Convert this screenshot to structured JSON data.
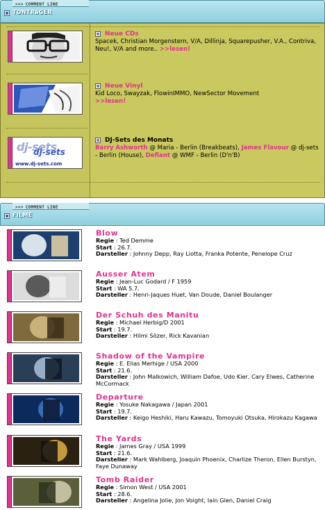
{
  "tontraeger_header": {
    "sub": "COMMENT LINE",
    "chevrons": ">>>",
    "title": "TONTRäGER"
  },
  "filme_header": {
    "sub": "COMMENT LINE",
    "chevrons": ">>>",
    "title": "FILME"
  },
  "music": [
    {
      "heading": "Neue CDs",
      "body": "Spacek, Christian Morgenstern, V/A, Dillinja, Squarepusher, V.A., Contriva, Neu!, V/A and more..",
      "link": ">>lesen!"
    },
    {
      "heading": "Neue Vinyl",
      "body": "Kid Loco, Swayzak, FlowinIMMO, NewSector Movement",
      "link": ">>lesen!"
    },
    {
      "heading": "DJ-Sets des Monats",
      "parts": [
        {
          "t": "Barry Ashworth",
          "pink": true
        },
        {
          "t": " @ Maria - Berlin (Breakbeats), ",
          "pink": false
        },
        {
          "t": "James Flavour",
          "pink": true
        },
        {
          "t": " @ dj-sets - Berlin (House), ",
          "pink": false
        },
        {
          "t": "Defiant",
          "pink": true
        },
        {
          "t": " @ WMF - Berlin (D'n'B)",
          "pink": false
        }
      ],
      "logo": {
        "line1": "dj-sets",
        "line2": "dj-sets",
        "url": "www.dj-sets.com"
      }
    }
  ],
  "labels": {
    "regie": "Regie",
    "start": "Start",
    "darsteller": "Darsteller",
    "sep": " : "
  },
  "films": [
    {
      "title": "Blow",
      "regie": "Ted Demme",
      "start": "26.7.",
      "darsteller": "Johnny Depp, Ray Liotta, Franka Potente, Penelope Cruz"
    },
    {
      "title": "Ausser Atem",
      "regie": "Jean-Luc Godard / F 1959",
      "start": "WA 5.7.",
      "darsteller": "Henri-Jaques Huet, Van Doude, Daniel Boulanger"
    },
    {
      "title": "Der Schuh des Manitu",
      "regie": "Michael Herbig/D 2001",
      "start": "19.7.",
      "darsteller": "Hilmi Sözer, Rick Kavanian"
    },
    {
      "title": "Shadow of the Vampire",
      "regie": "E. Elias Merhige / USA 2000",
      "start": "21.6.",
      "darsteller": "John Malkowich, William Dafoe, Udo Kier, Cary Elwes, Catherine McCormack"
    },
    {
      "title": "Departure",
      "regie": "Yosuke Nakagawa / Japan 2001",
      "start": "19.7.",
      "darsteller": "Keigo Heshiki, Haru Kawazu, Tomoyuki Otsuka, Hirokazu Kagawa"
    },
    {
      "title": "The Yards",
      "regie": "James Gray / USA 1999",
      "start": "21.6.",
      "darsteller": "Mark Wahlberg, Joaquin Phoenix, Charlize Theron, Ellen Burstyn, Faye Dunaway"
    },
    {
      "title": "Tomb Raider",
      "regie": "Simon West / USA 2001",
      "start": "28.6.",
      "darsteller": " Angelina Jolie, Jon Voight, Iain Glen, Daniel Craig"
    }
  ]
}
